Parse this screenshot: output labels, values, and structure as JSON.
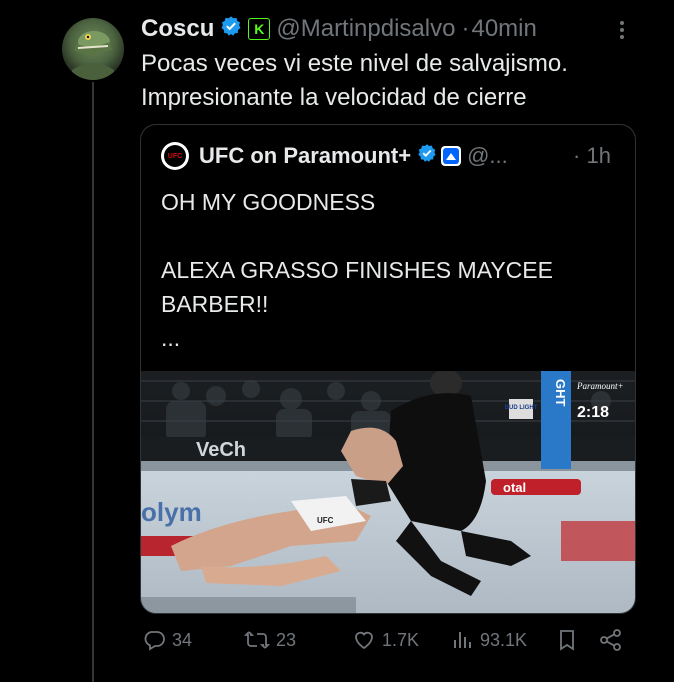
{
  "tweet": {
    "author_name": "Coscu",
    "handle": "@Martinpdisalvo",
    "separator": "·",
    "time": "40min",
    "text_lines": [
      "Pocas veces vi este nivel de salvajismo.",
      "Impresionante la velocidad de cierre"
    ],
    "kick_badge": "K"
  },
  "quote": {
    "logo_text": "UFC",
    "author_name": "UFC on Paramount+",
    "handle": "@...",
    "separator": "·",
    "time": "1h",
    "text_lines": [
      "OH MY GOODNESS",
      "",
      "ALEXA GRASSO FINISHES MAYCEE",
      "BARBER!!",
      "..."
    ],
    "media": {
      "scoreboard_brand": "Paramount+",
      "clock": "2:18",
      "corner_sign": "GHT",
      "logo_text": "BUD LIGHT",
      "banner_text": "VeCh",
      "mat_text": "otal",
      "mat_text_left": "olym",
      "shorts_logo": "UFC"
    }
  },
  "actions": {
    "replies": "34",
    "reposts": "23",
    "likes": "1.7K",
    "views": "93.1K"
  },
  "colors": {
    "background": "#000000",
    "text": "#e7e9ea",
    "muted": "#71767b",
    "verified": "#1d9bf0",
    "border": "#2f3336",
    "kick_green": "#53fc18"
  }
}
